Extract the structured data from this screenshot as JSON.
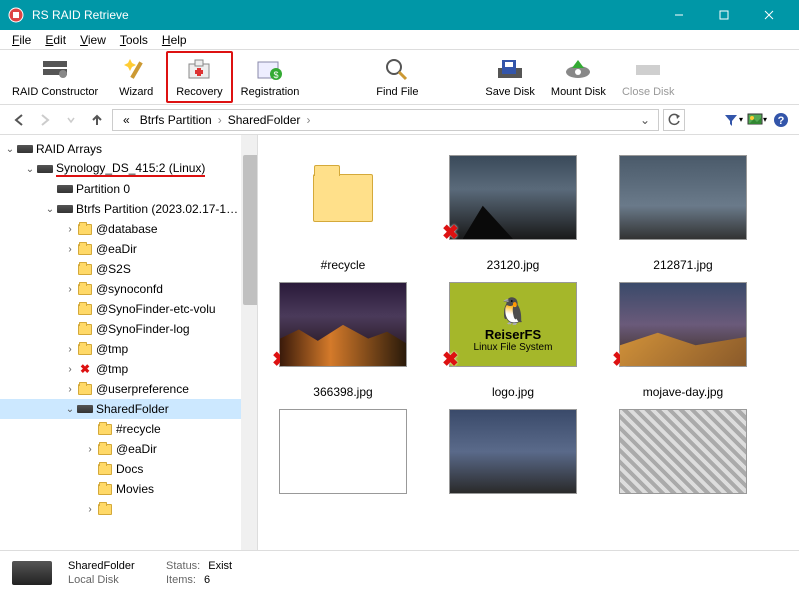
{
  "window": {
    "title": "RS RAID Retrieve"
  },
  "menu": {
    "file": "File",
    "edit": "Edit",
    "view": "View",
    "tools": "Tools",
    "help": "Help"
  },
  "toolbar": {
    "raid": "RAID Constructor",
    "wizard": "Wizard",
    "recovery": "Recovery",
    "registration": "Registration",
    "findfile": "Find File",
    "savedisk": "Save Disk",
    "mountdisk": "Mount Disk",
    "closedisk": "Close Disk"
  },
  "breadcrumb": {
    "pre": "«",
    "p1": "Btrfs Partition",
    "p2": "SharedFolder"
  },
  "tree": {
    "root": "RAID Arrays",
    "device": "Synology_DS_415:2 (Linux)",
    "part0": "Partition 0",
    "btrfs": "Btrfs Partition (2023.02.17-1…",
    "items": [
      "@database",
      "@eaDir",
      "@S2S",
      "@synoconfd",
      "@SynoFinder-etc-volu",
      "@SynoFinder-log",
      "@tmp",
      "@tmp",
      "@userpreference"
    ],
    "shared": "SharedFolder",
    "sub": [
      "#recycle",
      "@eaDir",
      "Docs",
      "Movies"
    ]
  },
  "files": {
    "recycle": "#recycle",
    "f1": "23120.jpg",
    "f2": "212871.jpg",
    "f3": "366398.jpg",
    "f4": "logo.jpg",
    "f5": "mojave-day.jpg",
    "logo_t1": "ReiserFS",
    "logo_t2": "Linux File System"
  },
  "status": {
    "name": "SharedFolder",
    "type": "Local Disk",
    "status_lbl": "Status:",
    "status_val": "Exist",
    "items_lbl": "Items:",
    "items_val": "6"
  }
}
